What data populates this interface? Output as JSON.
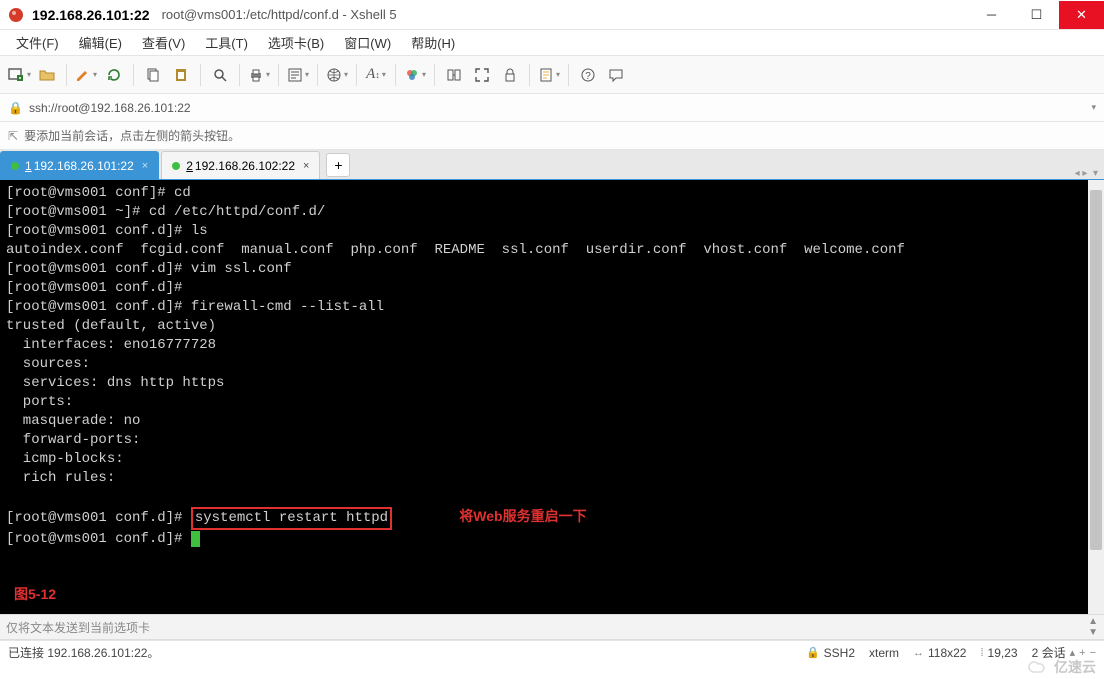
{
  "window": {
    "ip": "192.168.26.101:22",
    "path": "root@vms001:/etc/httpd/conf.d - Xshell 5"
  },
  "menu": {
    "file": "文件(F)",
    "edit": "编辑(E)",
    "view": "查看(V)",
    "tools": "工具(T)",
    "tabs": "选项卡(B)",
    "window": "窗口(W)",
    "help": "帮助(H)"
  },
  "address": {
    "url": "ssh://root@192.168.26.101:22"
  },
  "tip": {
    "text": "要添加当前会话，点击左侧的箭头按钮。"
  },
  "tabs": [
    {
      "num": "1",
      "label": "192.168.26.101:22",
      "active": true
    },
    {
      "num": "2",
      "label": "192.168.26.102:22",
      "active": false
    }
  ],
  "terminal": {
    "lines": [
      "[root@vms001 conf]# cd",
      "[root@vms001 ~]# cd /etc/httpd/conf.d/",
      "[root@vms001 conf.d]# ls",
      "autoindex.conf  fcgid.conf  manual.conf  php.conf  README  ssl.conf  userdir.conf  vhost.conf  welcome.conf",
      "[root@vms001 conf.d]# vim ssl.conf",
      "[root@vms001 conf.d]#",
      "[root@vms001 conf.d]# firewall-cmd --list-all",
      "trusted (default, active)",
      "  interfaces: eno16777728",
      "  sources:",
      "  services: dns http https",
      "  ports:",
      "  masquerade: no",
      "  forward-ports:",
      "  icmp-blocks:",
      "  rich rules:",
      ""
    ],
    "highlight_prompt": "[root@vms001 conf.d]# ",
    "highlight_cmd": "systemctl restart httpd",
    "annotation": "将Web服务重启一下",
    "cursor_prompt": "[root@vms001 conf.d]# ",
    "figure_label": "图5-12"
  },
  "sendbar": {
    "placeholder": "仅将文本发送到当前选项卡"
  },
  "status": {
    "conn": "已连接 192.168.26.101:22。",
    "proto": "SSH2",
    "term": "xterm",
    "size": "118x22",
    "pos": "19,23",
    "sessions": "2 会话"
  },
  "watermark": "亿速云",
  "icons": {
    "new_window": "new-window",
    "open": "open",
    "edit_pencil": "edit",
    "reconnect": "reconnect",
    "copy": "copy",
    "paste": "paste",
    "search": "search",
    "print": "print",
    "props": "properties",
    "globe": "globe",
    "font": "font",
    "colors": "colors",
    "fullscreen": "fullscreen",
    "lock": "lock",
    "script": "script",
    "help": "help",
    "chat": "chat"
  }
}
